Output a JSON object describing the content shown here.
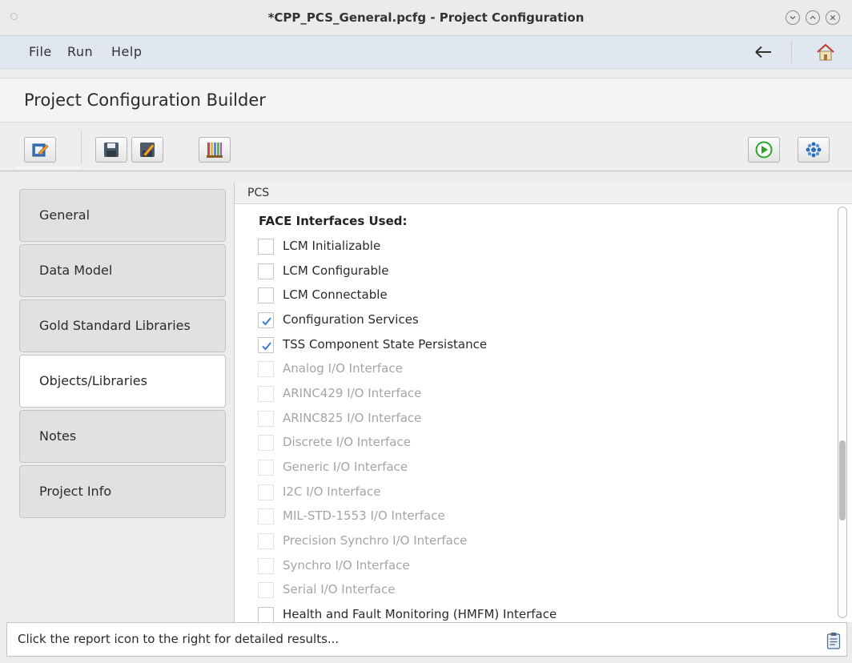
{
  "window": {
    "title": "*CPP_PCS_General.pcfg - Project Configuration"
  },
  "menu": {
    "items": [
      "File",
      "Run",
      "Help"
    ]
  },
  "header": {
    "title": "Project Configuration Builder"
  },
  "toolbar": {
    "left_buttons": [
      "edit-icon",
      "save-icon",
      "save-as-icon",
      "library-icon"
    ],
    "right_buttons": [
      "run-icon",
      "settings-icon"
    ]
  },
  "nav": {
    "items": [
      "General",
      "Data Model",
      "Gold Standard Libraries",
      "Objects/Libraries",
      "Notes",
      "Project Info"
    ],
    "active": "Objects/Libraries"
  },
  "panel": {
    "title": "PCS",
    "section_title": "FACE Interfaces Used:",
    "checkboxes": [
      {
        "label": "LCM Initializable",
        "checked": false,
        "enabled": true
      },
      {
        "label": "LCM Configurable",
        "checked": false,
        "enabled": true
      },
      {
        "label": "LCM Connectable",
        "checked": false,
        "enabled": true
      },
      {
        "label": "Configuration Services",
        "checked": true,
        "enabled": true
      },
      {
        "label": "TSS Component State Persistance",
        "checked": true,
        "enabled": true
      },
      {
        "label": "Analog I/O Interface",
        "checked": false,
        "enabled": false
      },
      {
        "label": "ARINC429 I/O Interface",
        "checked": false,
        "enabled": false
      },
      {
        "label": "ARINC825 I/O Interface",
        "checked": false,
        "enabled": false
      },
      {
        "label": "Discrete I/O Interface",
        "checked": false,
        "enabled": false
      },
      {
        "label": "Generic I/O Interface",
        "checked": false,
        "enabled": false
      },
      {
        "label": "I2C I/O Interface",
        "checked": false,
        "enabled": false
      },
      {
        "label": "MIL-STD-1553 I/O Interface",
        "checked": false,
        "enabled": false
      },
      {
        "label": "Precision Synchro I/O Interface",
        "checked": false,
        "enabled": false
      },
      {
        "label": "Synchro I/O Interface",
        "checked": false,
        "enabled": false
      },
      {
        "label": "Serial I/O Interface",
        "checked": false,
        "enabled": false
      },
      {
        "label": "Health and Fault Monitoring (HMFM) Interface",
        "checked": false,
        "enabled": true
      }
    ]
  },
  "status": {
    "message": "Click the report icon to the right for detailed results..."
  },
  "colors": {
    "menubar": "#e0e7f1",
    "check": "#3b7dd8",
    "run_green": "#2aa52a"
  }
}
